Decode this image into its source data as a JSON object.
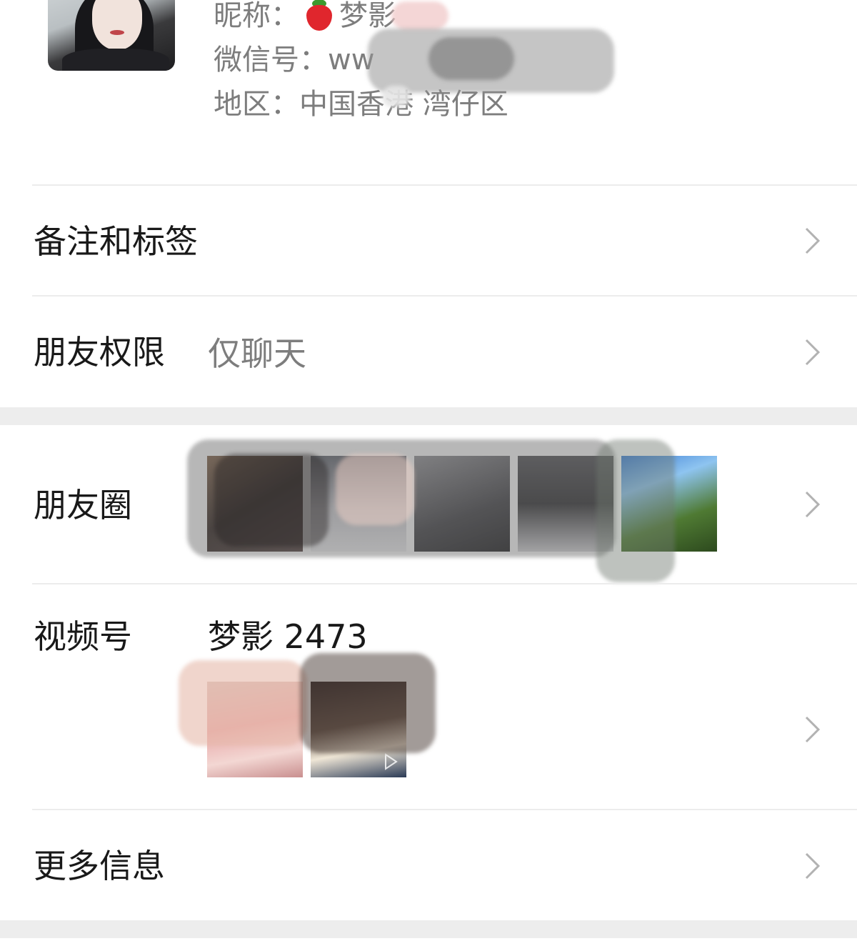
{
  "profile": {
    "nickname_label": "昵称：",
    "nickname_value": "梦影",
    "wechat_label": "微信号：",
    "wechat_value": "ww",
    "region_label": "地区：",
    "region_value": "中国香港 湾仔区"
  },
  "rows": {
    "remarks": {
      "label": "备注和标签"
    },
    "permissions": {
      "label": "朋友权限",
      "value": "仅聊天"
    },
    "moments": {
      "label": "朋友圈"
    },
    "channels": {
      "label": "视频号",
      "value": "梦影 2473"
    },
    "more_info": {
      "label": "更多信息"
    }
  },
  "icons": [
    "chevron-right-icon",
    "strawberry-icon"
  ],
  "colors": {
    "background": "#ffffff",
    "section_gap": "#ededed",
    "secondary_text": "#7d7d7d",
    "primary_text": "#191919"
  }
}
